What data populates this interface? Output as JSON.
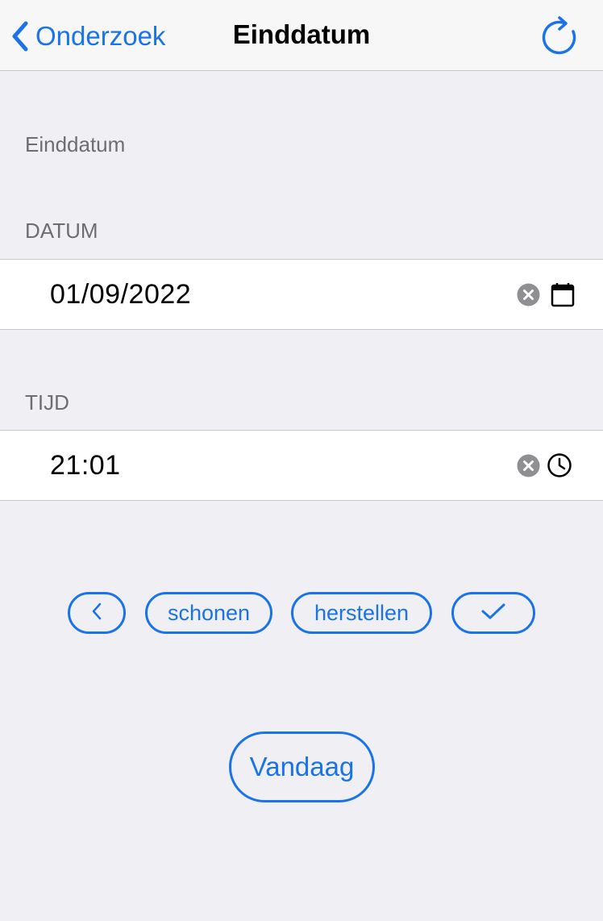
{
  "colors": {
    "accent": "#1a73e8",
    "background": "#efeff4",
    "navbar": "#f7f7f7",
    "row": "#ffffff",
    "section_label": "#6d6d72",
    "clear_icon": "#8e8e93"
  },
  "navbar": {
    "back_label": "Onderzoek",
    "back_icon": "chevron-left-icon",
    "title": "Einddatum",
    "refresh_icon": "refresh-icon"
  },
  "form": {
    "header": "Einddatum",
    "date": {
      "label": "DATUM",
      "value": "01/09/2022",
      "clear_icon": "clear-icon",
      "picker_icon": "calendar-icon"
    },
    "time": {
      "label": "TIJD",
      "value": "21:01",
      "clear_icon": "clear-icon",
      "picker_icon": "clock-icon"
    }
  },
  "actions": {
    "previous_icon": "chevron-left-icon",
    "clear_label": "schonen",
    "restore_label": "herstellen",
    "confirm_icon": "checkmark-icon",
    "today_label": "Vandaag"
  }
}
